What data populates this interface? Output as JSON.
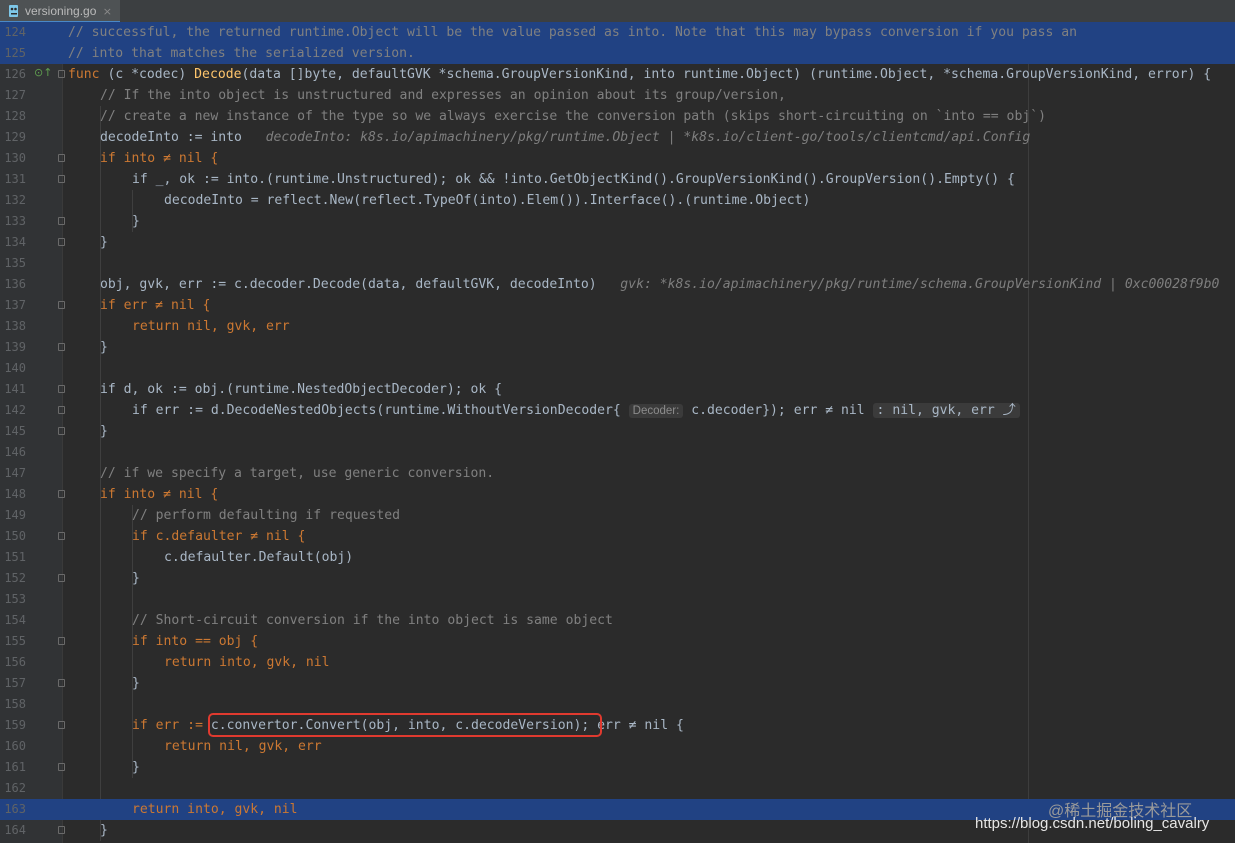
{
  "tab": {
    "filename": "versioning.go",
    "close_glyph": "×"
  },
  "colors": {
    "background": "#2b2b2b",
    "keyword": "#cc7832",
    "comment": "#808080",
    "type": "#4eade5",
    "function": "#ffc66d",
    "highlight": "#214283",
    "annotation_box": "#e03a2f"
  },
  "lines": [
    {
      "n": "124"
    },
    {
      "n": "125"
    },
    {
      "n": "126"
    },
    {
      "n": "127"
    },
    {
      "n": "128"
    },
    {
      "n": "129"
    },
    {
      "n": "130"
    },
    {
      "n": "131"
    },
    {
      "n": "132"
    },
    {
      "n": "133"
    },
    {
      "n": "134"
    },
    {
      "n": "135"
    },
    {
      "n": "136"
    },
    {
      "n": "137"
    },
    {
      "n": "138"
    },
    {
      "n": "139"
    },
    {
      "n": "140"
    },
    {
      "n": "141"
    },
    {
      "n": "142"
    },
    {
      "n": "145"
    },
    {
      "n": "146"
    },
    {
      "n": "147"
    },
    {
      "n": "148"
    },
    {
      "n": "149"
    },
    {
      "n": "150"
    },
    {
      "n": "151"
    },
    {
      "n": "152"
    },
    {
      "n": "153"
    },
    {
      "n": "154"
    },
    {
      "n": "155"
    },
    {
      "n": "156"
    },
    {
      "n": "157"
    },
    {
      "n": "158"
    },
    {
      "n": "159"
    },
    {
      "n": "160"
    },
    {
      "n": "161"
    },
    {
      "n": "162"
    },
    {
      "n": "163"
    },
    {
      "n": "164"
    }
  ],
  "code": {
    "l124": "// successful, the returned runtime.Object will be the value passed as into. Note that this may bypass conversion if you pass an",
    "l125": "// into that matches the serialized version.",
    "l126": {
      "kw": "func",
      "recv": "(c *codec)",
      "name": "Decode",
      "params": "(data []byte, defaultGVK *schema.GroupVersionKind, into runtime.Object)",
      "ret": "(runtime.Object, *schema.GroupVersionKind, error) {"
    },
    "l127": "// If the into object is unstructured and expresses an opinion about its group/version,",
    "l128": "// create a new instance of the type so we always exercise the conversion path (skips short-circuiting on `into == obj`)",
    "l129": {
      "code": "decodeInto := into",
      "hint": "decodeInto: k8s.io/apimachinery/pkg/runtime.Object | *k8s.io/client-go/tools/clientcmd/api.Config"
    },
    "l130": "if into ≠ nil {",
    "l131": "if _, ok := into.(runtime.Unstructured); ok && !into.GetObjectKind().GroupVersionKind().GroupVersion().Empty() {",
    "l132": "decodeInto = reflect.New(reflect.TypeOf(into).Elem()).Interface().(runtime.Object)",
    "l133": "}",
    "l134": "}",
    "l136": {
      "code": "obj, gvk, err := c.decoder.Decode(data, defaultGVK, decodeInto)",
      "hint": "gvk: *k8s.io/apimachinery/pkg/runtime/schema.GroupVersionKind | 0xc00028f9b0"
    },
    "l137": "if err ≠ nil {",
    "l138": "return nil, gvk, err",
    "l139": "}",
    "l141": "if d, ok := obj.(runtime.NestedObjectDecoder); ok {",
    "l142": {
      "code1": "if err := d.DecodeNestedObjects(runtime.WithoutVersionDecoder{",
      "param_hint": "Decoder:",
      "code2": "c.decoder}); err ≠ nil",
      "folded": ": nil, gvk, err ⤴"
    },
    "l145": "}",
    "l147": "// if we specify a target, use generic conversion.",
    "l148": "if into ≠ nil {",
    "l149": "// perform defaulting if requested",
    "l150": "if c.defaulter ≠ nil {",
    "l151": "c.defaulter.Default(obj)",
    "l152": "}",
    "l154": "// Short-circuit conversion if the into object is same object",
    "l155": "if into == obj {",
    "l156": "return into, gvk, nil",
    "l157": "}",
    "l159": {
      "pre": "if err :=",
      "boxed": "c.convertor.Convert(obj, into, c.decodeVersion);",
      "post": "err ≠ nil {"
    },
    "l160": "return nil, gvk, err",
    "l161": "}",
    "l163": "return into, gvk, nil",
    "l164": "}"
  },
  "watermark": {
    "line1": "@稀土掘金技术社区",
    "line2": "https://blog.csdn.net/boling_cavalry"
  }
}
